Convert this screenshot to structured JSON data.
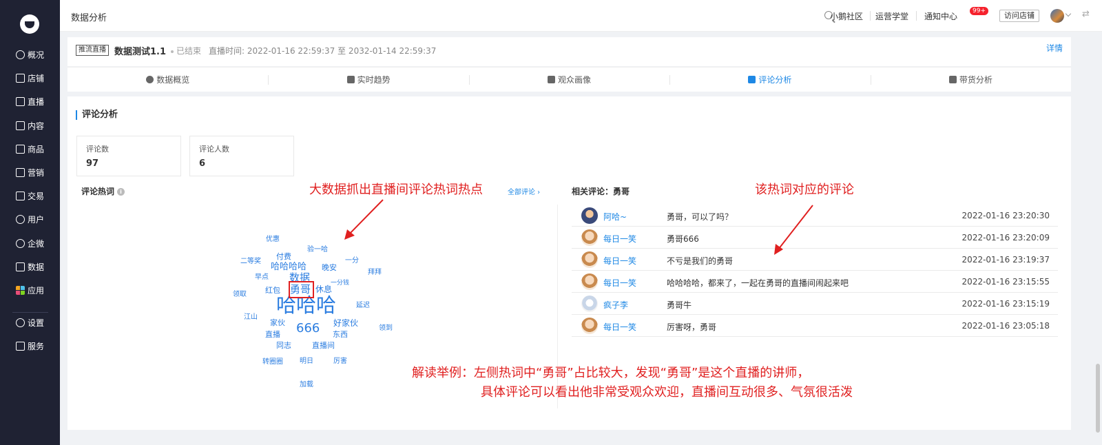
{
  "sidebar": {
    "items": [
      {
        "label": "概况"
      },
      {
        "label": "店铺"
      },
      {
        "label": "直播"
      },
      {
        "label": "内容"
      },
      {
        "label": "商品"
      },
      {
        "label": "营销"
      },
      {
        "label": "交易"
      },
      {
        "label": "用户"
      },
      {
        "label": "企微"
      },
      {
        "label": "数据"
      },
      {
        "label": "应用"
      }
    ],
    "bottom": [
      {
        "label": "设置"
      },
      {
        "label": "服务"
      }
    ]
  },
  "header": {
    "title": "数据分析",
    "links": [
      "小鹅社区",
      "运营学堂",
      "通知中心"
    ],
    "badge": "99+",
    "visit_button": "访问店铺"
  },
  "live": {
    "tag": "推流直播",
    "name": "数据测试1.1",
    "status": "已结束",
    "time": "直播时间: 2022-01-16 22:59:37 至 2032-01-14 22:59:37",
    "detail_link": "详情"
  },
  "tabs": [
    {
      "label": "数据概览"
    },
    {
      "label": "实时趋势"
    },
    {
      "label": "观众画像"
    },
    {
      "label": "评论分析",
      "active": true
    },
    {
      "label": "带货分析"
    }
  ],
  "section": {
    "title": "评论分析",
    "stats": [
      {
        "label": "评论数",
        "value": "97"
      },
      {
        "label": "评论人数",
        "value": "6"
      }
    ],
    "hot_words_title": "评论热词",
    "all_comments_link": "全部评论 ›",
    "related_title": "相关评论：勇哥"
  },
  "word_cloud": [
    {
      "text": "优惠"
    },
    {
      "text": "验一哈"
    },
    {
      "text": "付费"
    },
    {
      "text": "二等奖"
    },
    {
      "text": "哈哈哈哈"
    },
    {
      "text": "晚安"
    },
    {
      "text": "一分"
    },
    {
      "text": "拜拜"
    },
    {
      "text": "早点"
    },
    {
      "text": "数据"
    },
    {
      "text": "一分钱"
    },
    {
      "text": "红包"
    },
    {
      "text": "勇哥"
    },
    {
      "text": "休息"
    },
    {
      "text": "领取"
    },
    {
      "text": "哈哈哈"
    },
    {
      "text": "延迟"
    },
    {
      "text": "江山"
    },
    {
      "text": "家伙"
    },
    {
      "text": "666"
    },
    {
      "text": "好家伙"
    },
    {
      "text": "领到"
    },
    {
      "text": "直播"
    },
    {
      "text": "东西"
    },
    {
      "text": "同志"
    },
    {
      "text": "直播间"
    },
    {
      "text": "转圈圈"
    },
    {
      "text": "明日"
    },
    {
      "text": "厉害"
    },
    {
      "text": "加载"
    }
  ],
  "comments": [
    {
      "user": "阿哈~",
      "text": "勇哥，可以了吗？",
      "time": "2022-01-16 23:20:30"
    },
    {
      "user": "每日一笑",
      "text": "勇哥666",
      "time": "2022-01-16 23:20:09"
    },
    {
      "user": "每日一笑",
      "text": "不亏是我们的勇哥",
      "time": "2022-01-16 23:19:37"
    },
    {
      "user": "每日一笑",
      "text": "哈哈哈哈，都来了，一起在勇哥的直播间闹起来吧",
      "time": "2022-01-16 23:15:55"
    },
    {
      "user": "疯子李",
      "text": "勇哥牛",
      "time": "2022-01-16 23:15:19"
    },
    {
      "user": "每日一笑",
      "text": "厉害呀，勇哥",
      "time": "2022-01-16 23:05:18"
    }
  ],
  "annotations": {
    "left": "大数据抓出直播间评论热词热点",
    "right": "该热词对应的评论",
    "explain_line1": "解读举例：左侧热词中“勇哥”占比较大，发现“勇哥”是这个直播的讲师，",
    "explain_line2": "具体评论可以看出他非常受观众欢迎，直播间互动很多、气氛很活泼"
  },
  "colors": {
    "sidebar_bg": "#1f2233",
    "accent": "#1e88e5",
    "annotation": "#e02020",
    "badge": "#f5222d"
  }
}
